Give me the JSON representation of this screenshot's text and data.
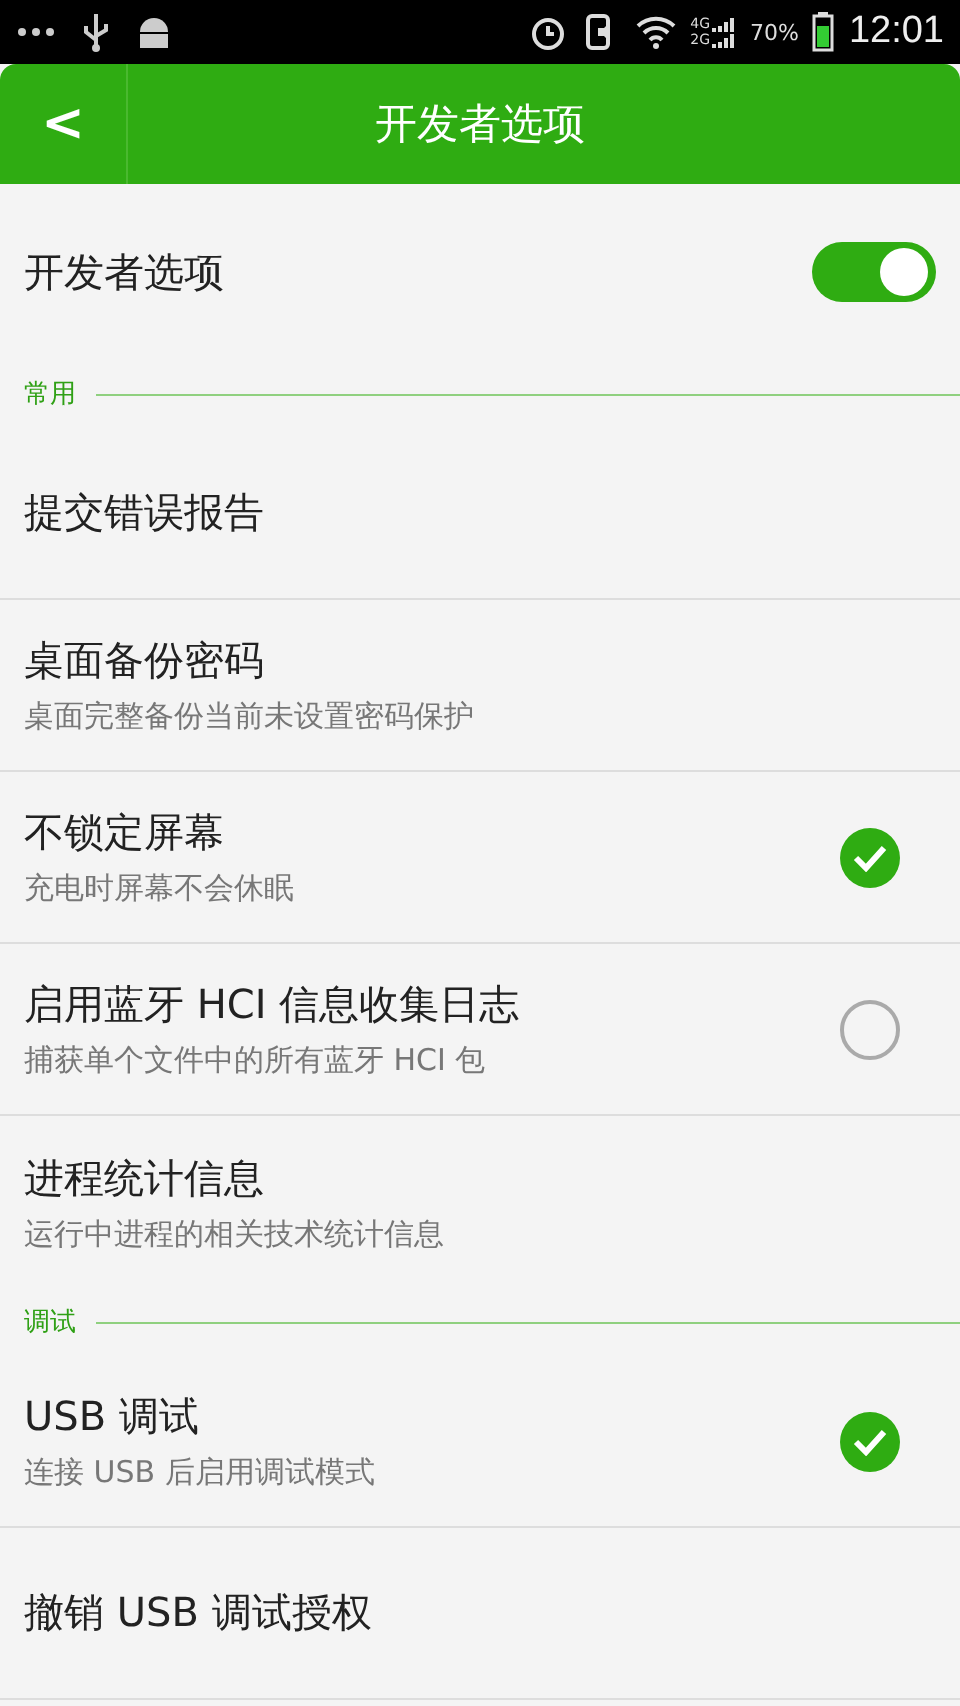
{
  "status_bar": {
    "network": [
      "4G",
      "2G"
    ],
    "battery": "70%",
    "time": "12:01"
  },
  "header": {
    "back": "<",
    "title": "开发者选项"
  },
  "master": {
    "label": "开发者选项",
    "on": true
  },
  "sections": [
    {
      "title": "常用",
      "items": [
        {
          "kind": "plain",
          "title": "提交错误报告"
        },
        {
          "kind": "plain",
          "title": "桌面备份密码",
          "subtitle": "桌面完整备份当前未设置密码保护"
        },
        {
          "kind": "check",
          "title": "不锁定屏幕",
          "subtitle": "充电时屏幕不会休眠",
          "checked": true
        },
        {
          "kind": "check",
          "title": "启用蓝牙 HCI 信息收集日志",
          "subtitle": "捕获单个文件中的所有蓝牙 HCI 包",
          "checked": false
        },
        {
          "kind": "plain",
          "title": "进程统计信息",
          "subtitle": "运行中进程的相关技术统计信息"
        }
      ]
    },
    {
      "title": "调试",
      "items": [
        {
          "kind": "check",
          "title": "USB 调试",
          "subtitle": "连接 USB 后启用调试模式",
          "checked": true
        },
        {
          "kind": "plain",
          "title": "撤销 USB 调试授权"
        }
      ]
    }
  ]
}
